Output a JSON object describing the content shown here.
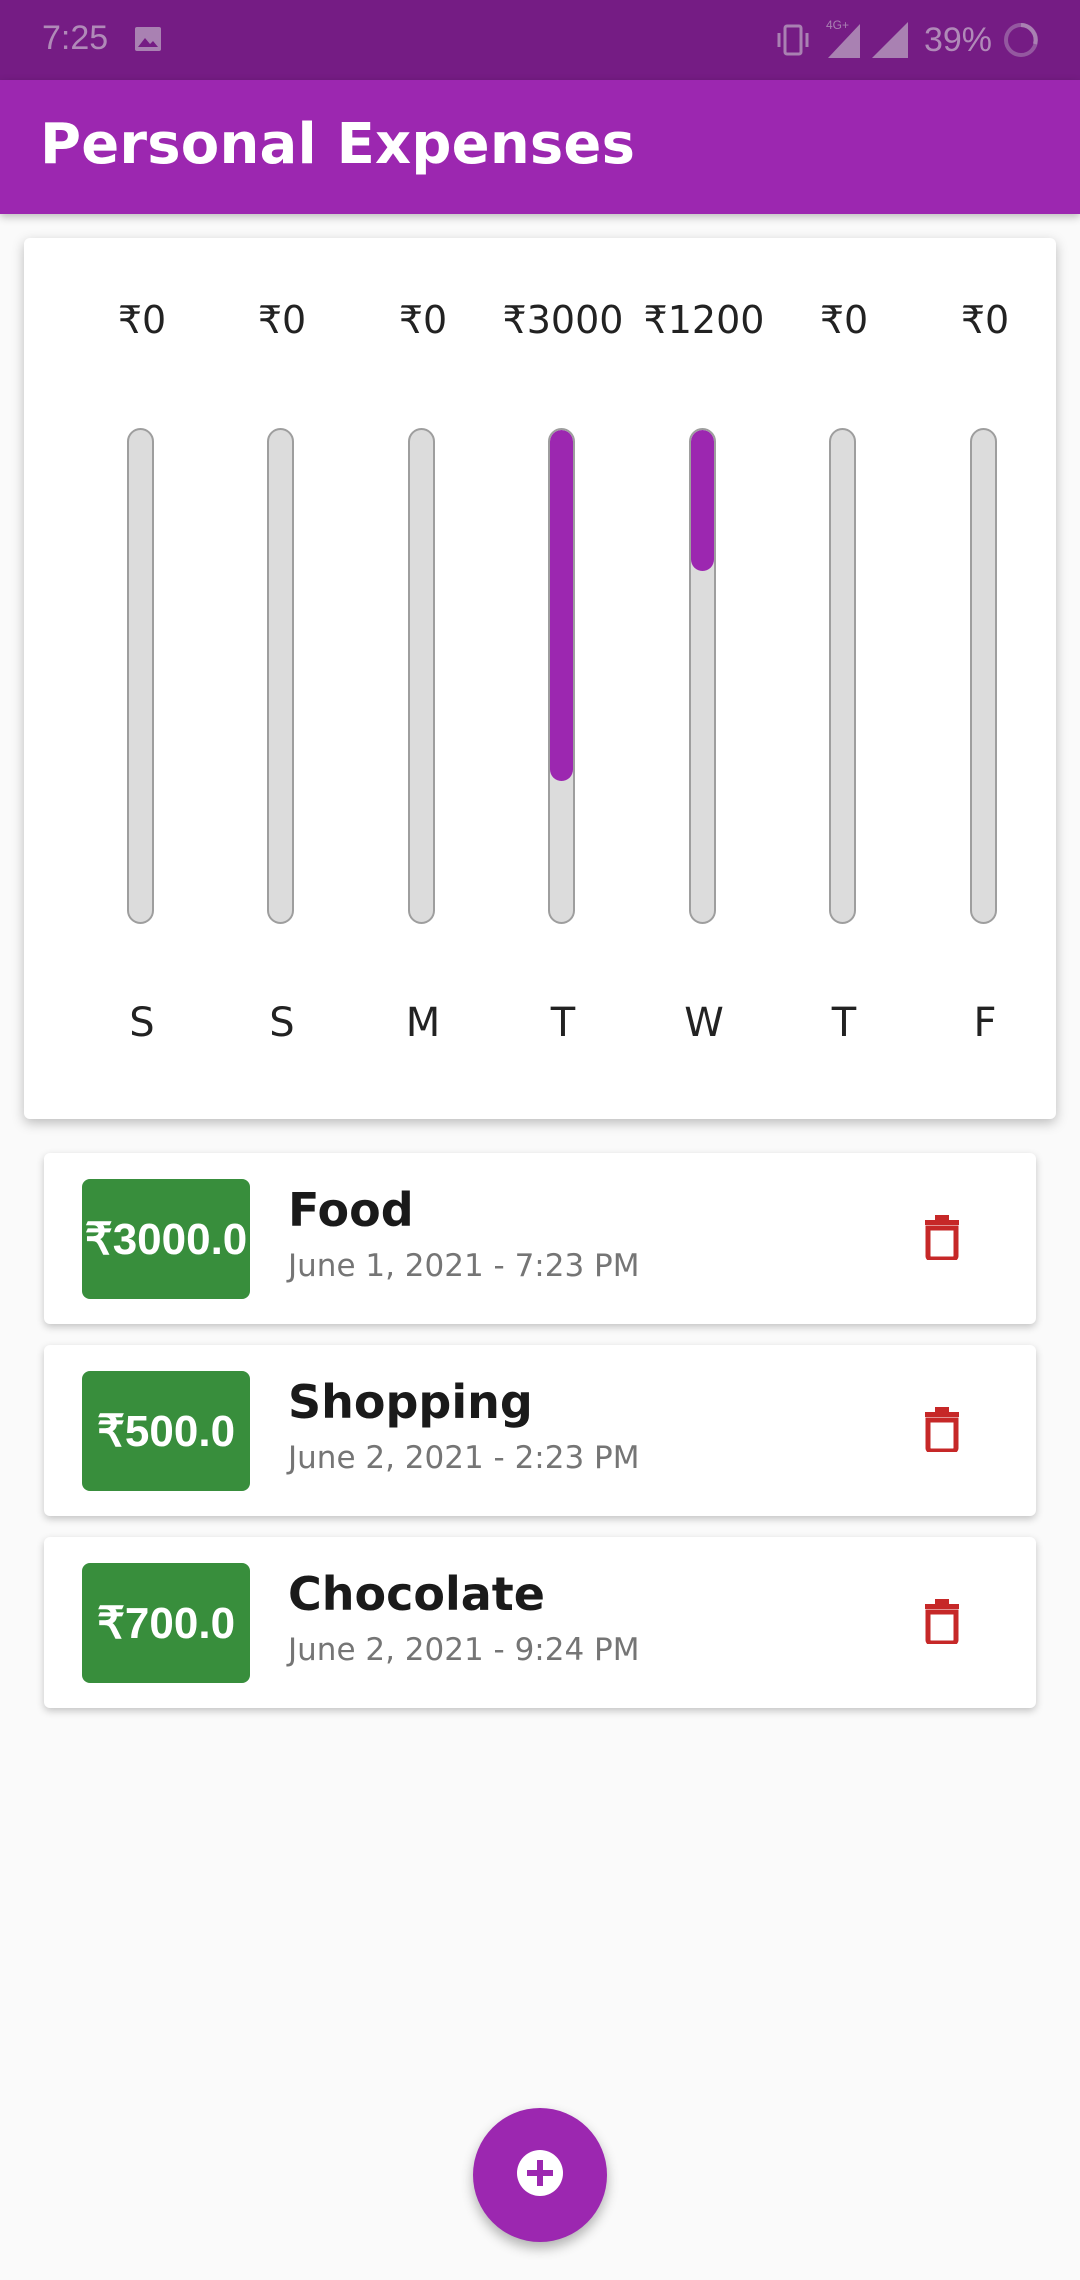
{
  "status_bar": {
    "time": "7:25",
    "battery_text": "39%",
    "network_label": "4G+",
    "icons": [
      "photo-icon",
      "vibrate-icon",
      "signal-icon",
      "signal-icon",
      "battery-icon"
    ]
  },
  "app_bar": {
    "title": "Personal Expenses"
  },
  "chart_data": {
    "type": "bar",
    "categories": [
      "S",
      "S",
      "M",
      "T",
      "W",
      "T",
      "F"
    ],
    "values": [
      0,
      0,
      0,
      3000,
      1200,
      0,
      0
    ],
    "amount_labels": [
      "₹0",
      "₹0",
      "₹0",
      "₹3000",
      "₹1200",
      "₹0",
      "₹0"
    ],
    "fill_fractions": [
      0,
      0,
      0,
      0.7143,
      0.2857,
      0,
      0
    ],
    "total": 4200,
    "fill_color": "#9c27b0",
    "track_color": "#dcdcdc"
  },
  "transactions": [
    {
      "amount": "₹3000.0",
      "title": "Food",
      "date": "June 1, 2021 - 7:23 PM"
    },
    {
      "amount": "₹500.0",
      "title": "Shopping",
      "date": "June 2, 2021 - 2:23 PM"
    },
    {
      "amount": "₹700.0",
      "title": "Chocolate",
      "date": "June 2, 2021 - 9:24 PM"
    }
  ],
  "colors": {
    "primary": "#9c27b0",
    "primary_dark": "#751c84",
    "amount_badge": "#388e3c",
    "delete_icon": "#c62828"
  },
  "fab": {
    "icon": "add-circle-icon"
  }
}
